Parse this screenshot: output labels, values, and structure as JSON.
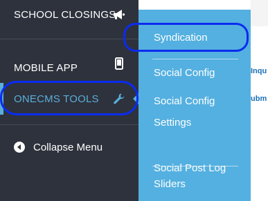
{
  "sidebar": {
    "items": [
      {
        "label": "SCHOOL CLOSINGS",
        "icon": "megaphone-icon"
      },
      {
        "label": "MOBILE APP",
        "icon": "mobile-phone-icon"
      },
      {
        "label": "ONECMS TOOLS",
        "icon": "wrench-icon",
        "active": true
      }
    ],
    "collapse_label": "Collapse Menu",
    "collapse_icon": "circle-arrow-left-icon"
  },
  "submenu": {
    "items": [
      {
        "label": "Syndication"
      },
      {
        "label": "Social Config"
      },
      {
        "label": "Social Config Settings"
      },
      {
        "label": "Social Post Log"
      },
      {
        "label": "Sliders"
      }
    ]
  },
  "background_page": {
    "snippets": [
      "Inqu",
      "ubm"
    ]
  },
  "colors": {
    "sidebar_bg": "#2e323c",
    "flyout_bg": "#54b0e0",
    "active_accent": "#5aaed9",
    "annotation_outline": "#0a2bf0"
  }
}
